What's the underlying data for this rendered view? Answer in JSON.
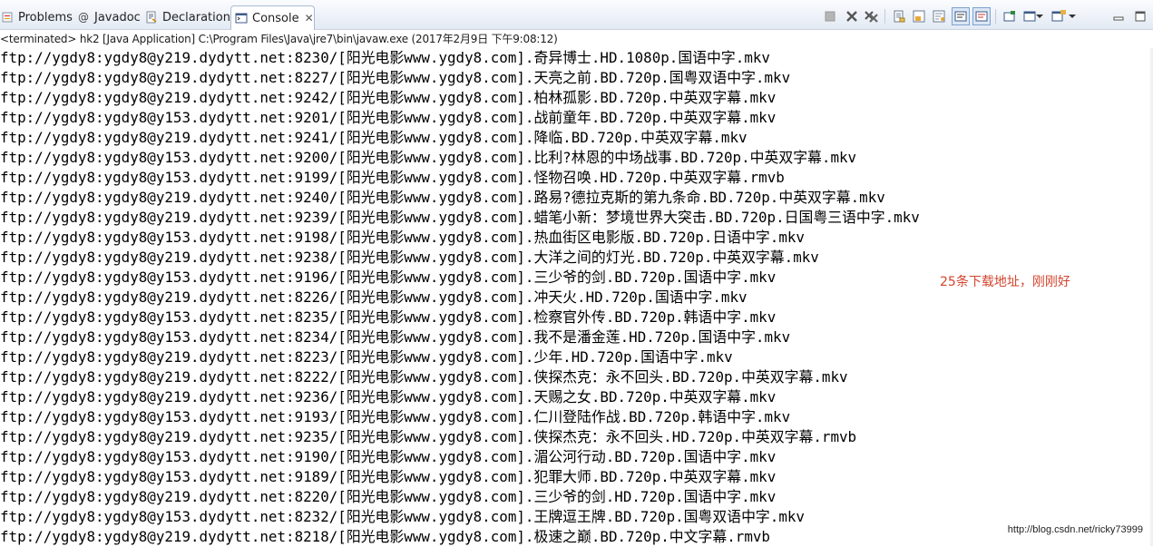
{
  "tabs": [
    {
      "label": "Problems",
      "icon": "problems-icon",
      "active": false
    },
    {
      "label": "Javadoc",
      "icon": "javadoc-icon",
      "active": false
    },
    {
      "label": "Declaration",
      "icon": "declaration-icon",
      "active": false
    },
    {
      "label": "Console",
      "icon": "console-icon",
      "active": true
    }
  ],
  "toolbar_icons": [
    "terminate-icon",
    "remove-launch-icon",
    "remove-all-terminated-icon",
    "clear-console-icon",
    "scroll-lock-icon",
    "word-wrap-icon",
    "show-on-stdout-icon",
    "show-on-stderr-icon",
    "pin-console-icon",
    "display-selected-console-icon",
    "dropdown-arrow-icon",
    "open-console-icon",
    "dropdown-arrow-icon",
    "minimize-icon",
    "maximize-icon"
  ],
  "console": {
    "header": "<terminated> hk2 [Java Application] C:\\Program Files\\Java\\jre7\\bin\\javaw.exe (2017年2月9日 下午9:08:12)",
    "lines": [
      "ftp://ygdy8:ygdy8@y219.dydytt.net:8230/[阳光电影www.ygdy8.com].奇异博士.HD.1080p.国语中字.mkv",
      "ftp://ygdy8:ygdy8@y219.dydytt.net:8227/[阳光电影www.ygdy8.com].天亮之前.BD.720p.国粤双语中字.mkv",
      "ftp://ygdy8:ygdy8@y219.dydytt.net:9242/[阳光电影www.ygdy8.com].柏林孤影.BD.720p.中英双字幕.mkv",
      "ftp://ygdy8:ygdy8@y153.dydytt.net:9201/[阳光电影www.ygdy8.com].战前童年.BD.720p.中英双字幕.mkv",
      "ftp://ygdy8:ygdy8@y219.dydytt.net:9241/[阳光电影www.ygdy8.com].降临.BD.720p.中英双字幕.mkv",
      "ftp://ygdy8:ygdy8@y153.dydytt.net:9200/[阳光电影www.ygdy8.com].比利?林恩的中场战事.BD.720p.中英双字幕.mkv",
      "ftp://ygdy8:ygdy8@y153.dydytt.net:9199/[阳光电影www.ygdy8.com].怪物召唤.HD.720p.中英双字幕.rmvb",
      "ftp://ygdy8:ygdy8@y219.dydytt.net:9240/[阳光电影www.ygdy8.com].路易?德拉克斯的第九条命.BD.720p.中英双字幕.mkv",
      "ftp://ygdy8:ygdy8@y219.dydytt.net:9239/[阳光电影www.ygdy8.com].蜡笔小新：梦境世界大突击.BD.720p.日国粤三语中字.mkv",
      "ftp://ygdy8:ygdy8@y153.dydytt.net:9198/[阳光电影www.ygdy8.com].热血街区电影版.BD.720p.日语中字.mkv",
      "ftp://ygdy8:ygdy8@y219.dydytt.net:9238/[阳光电影www.ygdy8.com].大洋之间的灯光.BD.720p.中英双字幕.mkv",
      "ftp://ygdy8:ygdy8@y153.dydytt.net:9196/[阳光电影www.ygdy8.com].三少爷的剑.BD.720p.国语中字.mkv",
      "ftp://ygdy8:ygdy8@y219.dydytt.net:8226/[阳光电影www.ygdy8.com].冲天火.HD.720p.国语中字.mkv",
      "ftp://ygdy8:ygdy8@y153.dydytt.net:8235/[阳光电影www.ygdy8.com].检察官外传.BD.720p.韩语中字.mkv",
      "ftp://ygdy8:ygdy8@y153.dydytt.net:8234/[阳光电影www.ygdy8.com].我不是潘金莲.HD.720p.国语中字.mkv",
      "ftp://ygdy8:ygdy8@y219.dydytt.net:8223/[阳光电影www.ygdy8.com].少年.HD.720p.国语中字.mkv",
      "ftp://ygdy8:ygdy8@y219.dydytt.net:8222/[阳光电影www.ygdy8.com].侠探杰克：永不回头.BD.720p.中英双字幕.mkv",
      "ftp://ygdy8:ygdy8@y219.dydytt.net:9236/[阳光电影www.ygdy8.com].天赐之女.BD.720p.中英双字幕.mkv",
      "ftp://ygdy8:ygdy8@y153.dydytt.net:9193/[阳光电影www.ygdy8.com].仁川登陆作战.BD.720p.韩语中字.mkv",
      "ftp://ygdy8:ygdy8@y219.dydytt.net:9235/[阳光电影www.ygdy8.com].侠探杰克：永不回头.HD.720p.中英双字幕.rmvb",
      "ftp://ygdy8:ygdy8@y153.dydytt.net:9190/[阳光电影www.ygdy8.com].湄公河行动.BD.720p.国语中字.mkv",
      "ftp://ygdy8:ygdy8@y153.dydytt.net:9189/[阳光电影www.ygdy8.com].犯罪大师.BD.720p.中英双字幕.mkv",
      "ftp://ygdy8:ygdy8@y219.dydytt.net:8220/[阳光电影www.ygdy8.com].三少爷的剑.HD.720p.国语中字.mkv",
      "ftp://ygdy8:ygdy8@y153.dydytt.net:8232/[阳光电影www.ygdy8.com].王牌逗王牌.BD.720p.国粤双语中字.mkv",
      "ftp://ygdy8:ygdy8@y219.dydytt.net:8218/[阳光电影www.ygdy8.com].极速之巅.BD.720p.中文字幕.rmvb"
    ]
  },
  "annotation": "25条下载地址，刚刚好",
  "watermark": "http://blog.csdn.net/ricky73999",
  "colors": {
    "annotation": "#d2452e",
    "tab_active_border": "#a9bcd4",
    "toolbar_bg": "#e3eaf4"
  }
}
